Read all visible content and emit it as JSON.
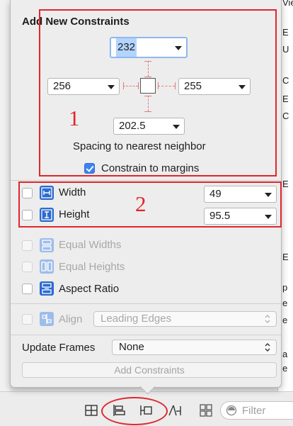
{
  "background": {
    "right_fragments": [
      "View",
      "E",
      "U",
      "C",
      "E",
      "C",
      "E",
      "E",
      "p",
      "e",
      "e",
      "a",
      "e"
    ],
    "filter_placeholder": "Filter"
  },
  "popover": {
    "title": "Add New Constraints",
    "spacing": {
      "top": "232",
      "left": "256",
      "right": "255",
      "bottom": "202.5",
      "caption": "Spacing to nearest neighbor"
    },
    "constrain_to_margins": {
      "label": "Constrain to margins",
      "checked": true
    },
    "size": {
      "width": {
        "label": "Width",
        "value": "49",
        "checked": false
      },
      "height": {
        "label": "Height",
        "value": "95.5",
        "checked": false
      }
    },
    "equal_widths": {
      "label": "Equal Widths",
      "enabled": false
    },
    "equal_heights": {
      "label": "Equal Heights",
      "enabled": false
    },
    "aspect_ratio": {
      "label": "Aspect Ratio",
      "enabled": true
    },
    "align": {
      "label": "Align",
      "value": "Leading Edges",
      "enabled": false
    },
    "update_frames": {
      "label": "Update Frames",
      "value": "None"
    },
    "add_button": "Add Constraints"
  },
  "annotations": {
    "box1": "1",
    "box2": "2"
  },
  "colors": {
    "accent": "#2c6ad0",
    "annotation": "#e0262b",
    "focus": "#8fb8ef",
    "strut": "#e27b7b"
  }
}
